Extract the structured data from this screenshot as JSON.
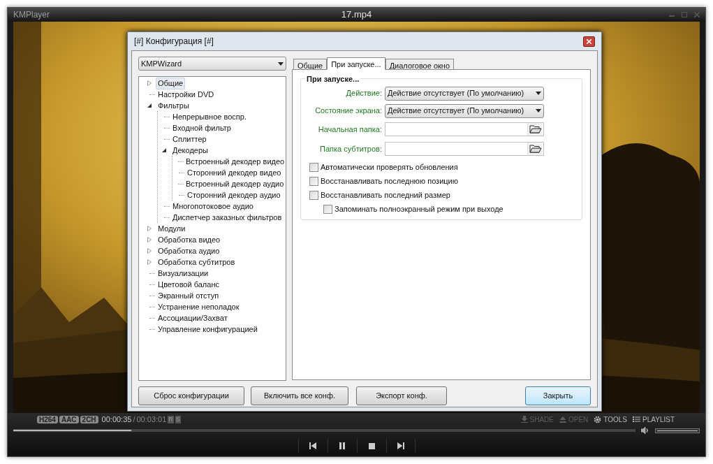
{
  "player": {
    "app_name": "KMPlayer",
    "file_title": "17.mp4",
    "status": {
      "badges": [
        "H264",
        "AAC",
        "2CH"
      ],
      "time_current": "00:00:35",
      "time_separator": "/",
      "time_total": "00:03:01",
      "flags": [
        "R",
        "S"
      ]
    },
    "toolbar": [
      {
        "label": "SHADE",
        "kind": "shade",
        "disabled": true
      },
      {
        "label": "OPEN",
        "kind": "open",
        "disabled": true
      },
      {
        "label": "TOOLS",
        "kind": "tools",
        "disabled": false
      },
      {
        "label": "PLAYLIST",
        "kind": "playlist",
        "disabled": false
      }
    ],
    "seek": {
      "level": 0.19
    },
    "volume": {
      "level": 1.0
    },
    "controls": [
      {
        "kind": "previous"
      },
      {
        "kind": "pause"
      },
      {
        "kind": "stop"
      },
      {
        "kind": "next"
      }
    ]
  },
  "dialog": {
    "title": "[#] Конфигурация [#]",
    "preset": "KMPWizard",
    "tree": [
      {
        "label": "Общие",
        "expanded": false,
        "selected": true
      },
      {
        "label": "Настройки DVD",
        "selected": false
      },
      {
        "label": "Фильтры",
        "expanded": true,
        "selected": false,
        "children": [
          {
            "label": "Непрерывное воспр.",
            "selected": false
          },
          {
            "label": "Входной фильтр",
            "selected": false
          },
          {
            "label": "Сплиттер",
            "selected": false
          },
          {
            "label": "Декодеры",
            "expanded": true,
            "selected": false,
            "children": [
              {
                "label": "Встроенный декодер видео",
                "selected": false
              },
              {
                "label": "Сторонний декодер видео",
                "selected": false
              },
              {
                "label": "Встроенный декодер аудио",
                "selected": false
              },
              {
                "label": "Сторонний декодер аудио",
                "selected": false
              }
            ]
          },
          {
            "label": "Многопотоковое аудио",
            "selected": false
          },
          {
            "label": "Диспетчер заказных фильтров",
            "selected": false
          }
        ]
      },
      {
        "label": "Модули",
        "expanded": false,
        "selected": false
      },
      {
        "label": "Обработка видео",
        "expanded": false,
        "selected": false
      },
      {
        "label": "Обработка аудио",
        "expanded": false,
        "selected": false
      },
      {
        "label": "Обработка субтитров",
        "expanded": false,
        "selected": false
      },
      {
        "label": "Визуализации",
        "selected": false
      },
      {
        "label": "Цветовой баланс",
        "selected": false
      },
      {
        "label": "Экранный отступ",
        "selected": false
      },
      {
        "label": "Устранение неполадок",
        "selected": false
      },
      {
        "label": "Ассоциации/Захват",
        "selected": false
      },
      {
        "label": "Управление конфигурацией",
        "selected": false
      }
    ],
    "tabs": [
      {
        "label": "Общие",
        "selected": false
      },
      {
        "label": "При запуске...",
        "selected": true
      },
      {
        "label": "Диалоговое окно",
        "selected": false
      }
    ],
    "group_title": "При запуске...",
    "fields": [
      {
        "kind": "dropdown",
        "label": "Действие:",
        "value": "Действие отсутствует (По умолчанию)"
      },
      {
        "kind": "dropdown",
        "label": "Состояние экрана:",
        "value": "Действие отсутствует (По умолчанию)"
      },
      {
        "kind": "folder",
        "label": "Начальная папка:"
      },
      {
        "kind": "folder",
        "label": "Папка субтитров:"
      }
    ],
    "checkboxes": [
      {
        "label": "Автоматически проверять обновления",
        "checked": false
      },
      {
        "label": "Восстанавливать последнюю позицию",
        "checked": false
      },
      {
        "label": "Восстанавливать последний размер",
        "checked": false,
        "children": [
          {
            "label": "Запоминать полноэкранный режим при выходе",
            "checked": false
          }
        ]
      }
    ],
    "buttons": [
      {
        "label": "Сброс конфигурации",
        "default": false
      },
      {
        "label": "Включить все конф.",
        "default": false
      },
      {
        "label": "Экспорт конф.",
        "default": false
      },
      {
        "label": "Закрыть",
        "default": true
      }
    ]
  }
}
